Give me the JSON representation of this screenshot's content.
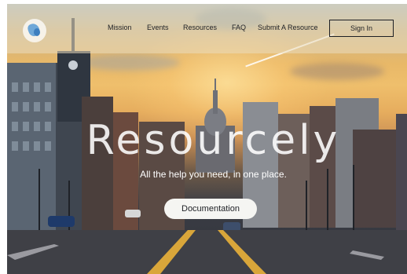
{
  "nav": {
    "logo": "Resourcely logo",
    "links": [
      {
        "label": "Mission"
      },
      {
        "label": "Events"
      },
      {
        "label": "Resources"
      },
      {
        "label": "FAQ"
      },
      {
        "label": "Submit A Resource"
      }
    ],
    "sign_in_label": "Sign In"
  },
  "hero": {
    "title": "Resourcely",
    "subtitle": "All the help you need, in one place.",
    "cta_label": "Documentation",
    "background": "city street with capitol dome at sunset"
  },
  "colors": {
    "navbar_overlay": "#ebdcbe",
    "text_dark": "#1d1f24",
    "button_bg": "#f5f5f2",
    "logo_blue": "#6fa8d8"
  }
}
